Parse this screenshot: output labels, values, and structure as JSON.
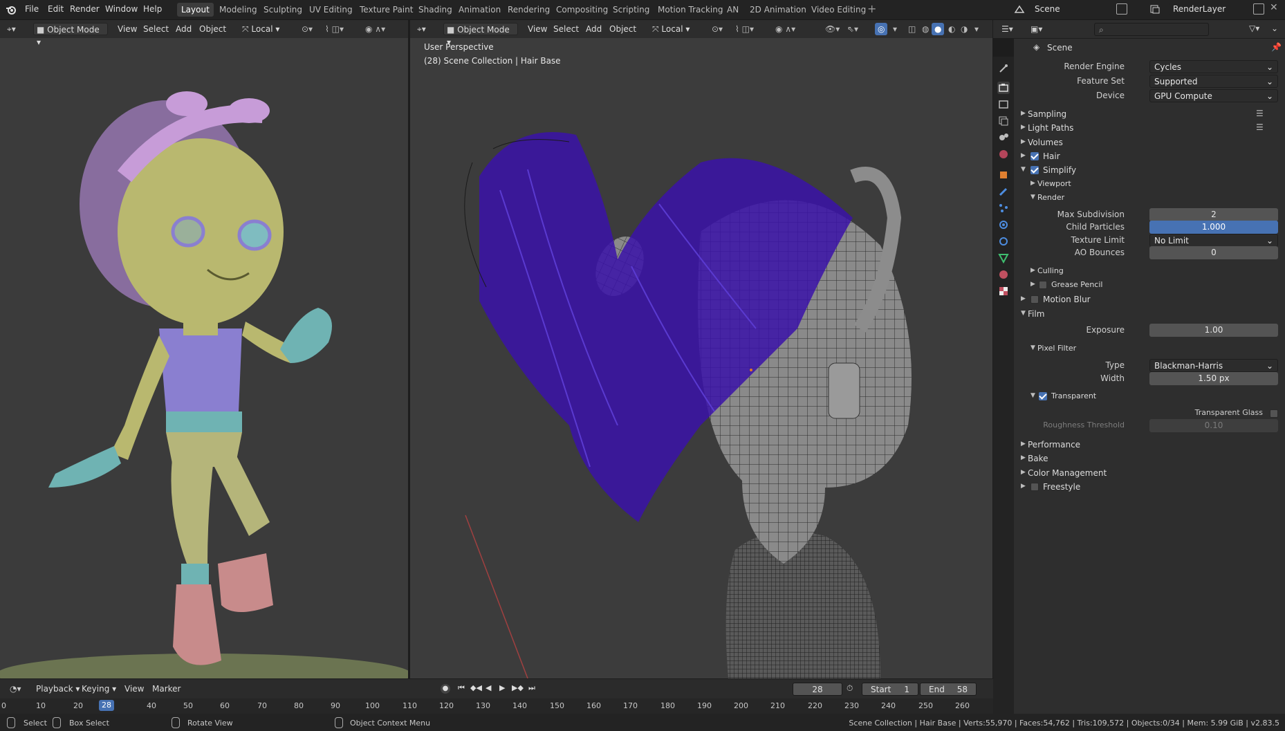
{
  "topbar": {
    "menus": [
      "File",
      "Edit",
      "Render",
      "Window",
      "Help"
    ],
    "workspaces": [
      "Layout",
      "Modeling",
      "Sculpting",
      "UV Editing",
      "Texture Paint",
      "Shading",
      "Animation",
      "Rendering",
      "Compositing",
      "Scripting",
      "Motion Tracking",
      "AN",
      "2D Animation",
      "Video Editing"
    ],
    "active_workspace": "Layout",
    "scene": "Scene",
    "view_layer": "RenderLayer"
  },
  "left_viewport": {
    "mode": "Object Mode",
    "menus": [
      "View",
      "Select",
      "Add",
      "Object"
    ],
    "orientation": "Local"
  },
  "main_viewport": {
    "mode": "Object Mode",
    "menus": [
      "View",
      "Select",
      "Add",
      "Object"
    ],
    "orientation": "Local",
    "overlay_title": "User Perspective",
    "overlay_subtitle": "(28) Scene Collection | Hair Base"
  },
  "properties": {
    "context_title": "Scene",
    "search_placeholder": "",
    "render_engine_label": "Render Engine",
    "render_engine": "Cycles",
    "feature_set_label": "Feature Set",
    "feature_set": "Supported",
    "device_label": "Device",
    "device": "GPU Compute",
    "sections": {
      "sampling": "Sampling",
      "light_paths": "Light Paths",
      "volumes": "Volumes",
      "hair": "Hair",
      "simplify": "Simplify",
      "viewport": "Viewport",
      "render": "Render",
      "culling": "Culling",
      "grease_pencil": "Grease Pencil",
      "motion_blur": "Motion Blur",
      "film": "Film",
      "pixel_filter": "Pixel Filter",
      "transparent": "Transparent",
      "performance": "Performance",
      "bake": "Bake",
      "color_management": "Color Management",
      "freestyle": "Freestyle"
    },
    "max_subdivision_label": "Max Subdivision",
    "max_subdivision": "2",
    "child_particles_label": "Child Particles",
    "child_particles": "1.000",
    "texture_limit_label": "Texture Limit",
    "texture_limit": "No Limit",
    "ao_bounces_label": "AO Bounces",
    "ao_bounces": "0",
    "exposure_label": "Exposure",
    "exposure": "1.00",
    "type_label": "Type",
    "filter_type": "Blackman-Harris",
    "width_label": "Width",
    "filter_width": "1.50 px",
    "transparent_glass_label": "Transparent Glass",
    "roughness_threshold_label": "Roughness Threshold",
    "roughness_threshold": "0.10"
  },
  "timeline": {
    "menus": [
      "Playback",
      "Keying",
      "View",
      "Marker"
    ],
    "current_frame": "28",
    "start_label": "Start",
    "start": "1",
    "end_label": "End",
    "end": "58",
    "ruler": [
      "0",
      "10",
      "20",
      "28",
      "40",
      "50",
      "60",
      "70",
      "80",
      "90",
      "100",
      "110",
      "120",
      "130",
      "140",
      "150",
      "160",
      "170",
      "180",
      "190",
      "200",
      "210",
      "220",
      "230",
      "240",
      "250",
      "260"
    ]
  },
  "status": {
    "select": "Select",
    "box_select": "Box Select",
    "rotate_view": "Rotate View",
    "context_menu": "Object Context Menu",
    "stats": "Scene Collection | Hair Base | Verts:55,970 | Faces:54,762 | Tris:109,572 | Objects:0/34 | Mem: 5.99 GiB | v2.83.5"
  },
  "colors": {
    "accent": "#4772b3",
    "hair": "#3a12a8",
    "skin": "#b9b86f",
    "shirt": "#8a7fd0",
    "gloves": "#6fb3b3",
    "boots": "#c98a8a"
  }
}
